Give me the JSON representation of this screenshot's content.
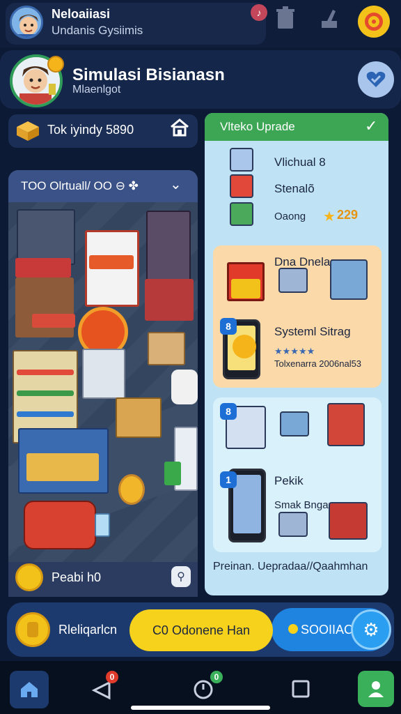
{
  "header": {
    "title": "Neloaiiasi",
    "subtitle": "Undanis Gysiimis",
    "notif_glyph": "♪",
    "icons": [
      "notification-icon",
      "trash-icon",
      "hammer-icon",
      "target-icon"
    ]
  },
  "profile": {
    "title": "Simulasi Bisianasn",
    "subtitle": "Mlaenlgot"
  },
  "shop": {
    "tok_label": "Tok iyindy 5890",
    "store_title": "TOO Olrtuall/ OO ⊖ ✤",
    "footer_label": "Peabi h0"
  },
  "upgrade": {
    "title": "Vlteko Uprade",
    "items": [
      {
        "label": "Vlichual 8"
      },
      {
        "label": "Stenalõ"
      },
      {
        "label": "Oaong",
        "price": "229"
      }
    ],
    "card_orange": {
      "title": "Dna Dnela:",
      "subtitle": "Systeml Sitrag",
      "stars": "★★★★★",
      "small_text": "Tolxenarra 2006nal53",
      "badge": "8"
    },
    "card_blue": {
      "badge_top": "8",
      "badge_phone": "1",
      "title": "Pekik",
      "subtitle": "Smak Bngan"
    },
    "footer": "Preinan. Uepradaa//Qaahmhan"
  },
  "action_bar": {
    "label": "Rleliqarlcn",
    "yellow_button": "C0 Odonene Han",
    "blue_button": "SOOIIAC"
  },
  "bottom_nav": {
    "items": [
      "home",
      "alert",
      "timer",
      "square",
      "profile"
    ],
    "alert_badge": "0",
    "timer_badge": "0"
  },
  "colors": {
    "background": "#0d1a36",
    "accent_green": "#3da655",
    "accent_yellow": "#f7d21c",
    "accent_blue": "#1f84e0"
  }
}
